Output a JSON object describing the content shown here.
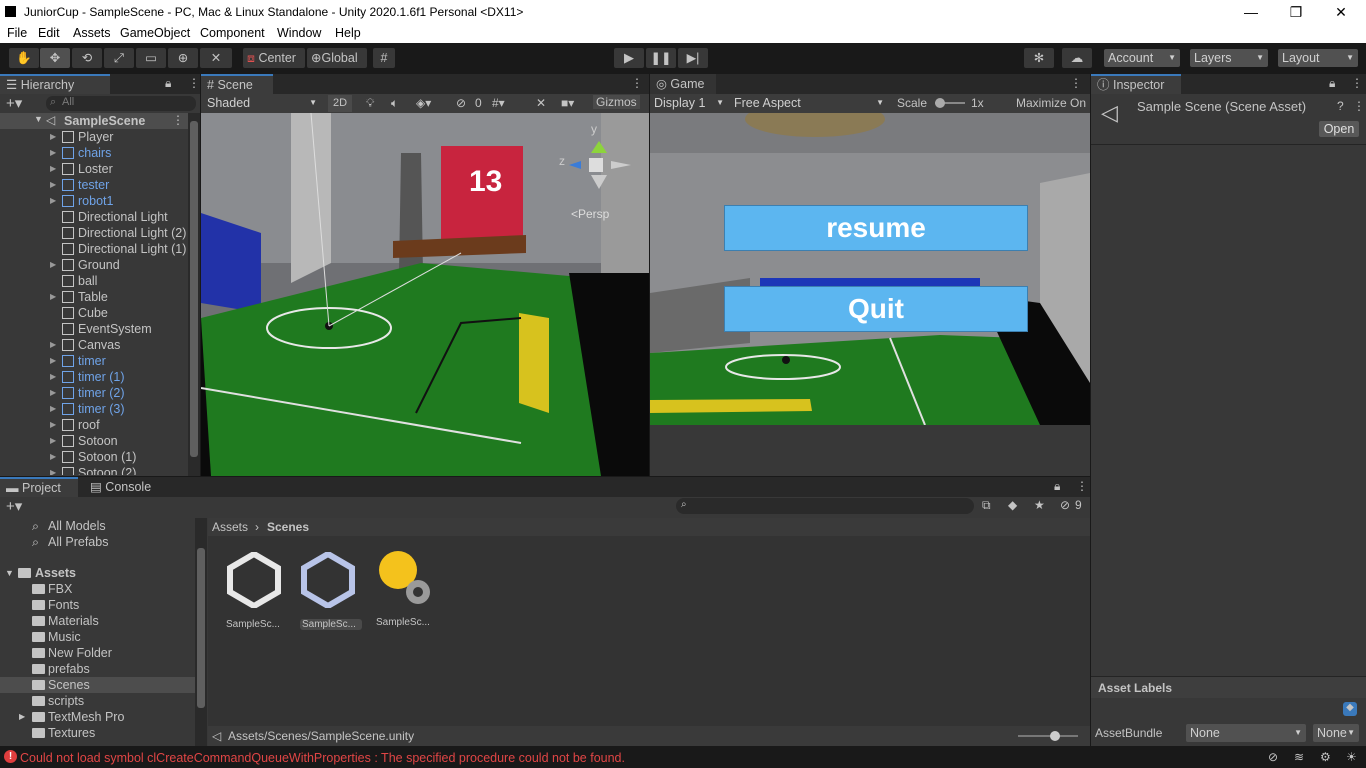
{
  "window": {
    "title": "JuniorCup - SampleScene - PC, Mac & Linux Standalone - Unity 2020.1.6f1 Personal <DX11>",
    "minimize": "—",
    "restore": "❐",
    "close": "✕"
  },
  "menu": [
    "File",
    "Edit",
    "Assets",
    "GameObject",
    "Component",
    "Window",
    "Help"
  ],
  "toolbar": {
    "center": "Center",
    "global": "Global",
    "account": "Account",
    "layers": "Layers",
    "layout": "Layout",
    "play_icon": "play-icon",
    "pause_icon": "pause-icon",
    "step_icon": "step-icon"
  },
  "hierarchy": {
    "tab": "Hierarchy",
    "search_placeholder": "All",
    "scene": "SampleScene",
    "items": [
      {
        "label": "Player",
        "prefab": false,
        "expand": true
      },
      {
        "label": "chairs",
        "prefab": true,
        "expand": true
      },
      {
        "label": "Loster",
        "prefab": false,
        "expand": true
      },
      {
        "label": "tester",
        "prefab": true,
        "expand": true
      },
      {
        "label": "robot1",
        "prefab": true,
        "expand": true
      },
      {
        "label": "Directional Light",
        "prefab": false,
        "expand": false
      },
      {
        "label": "Directional Light (2)",
        "prefab": false,
        "expand": false
      },
      {
        "label": "Directional Light (1)",
        "prefab": false,
        "expand": false
      },
      {
        "label": "Ground",
        "prefab": false,
        "expand": true
      },
      {
        "label": "ball",
        "prefab": false,
        "expand": false
      },
      {
        "label": "Table",
        "prefab": false,
        "expand": true
      },
      {
        "label": "Cube",
        "prefab": false,
        "expand": false
      },
      {
        "label": "EventSystem",
        "prefab": false,
        "expand": false
      },
      {
        "label": "Canvas",
        "prefab": false,
        "expand": true
      },
      {
        "label": "timer",
        "prefab": true,
        "expand": true
      },
      {
        "label": "timer (1)",
        "prefab": true,
        "expand": true
      },
      {
        "label": "timer (2)",
        "prefab": true,
        "expand": true
      },
      {
        "label": "timer (3)",
        "prefab": true,
        "expand": true
      },
      {
        "label": "roof",
        "prefab": false,
        "expand": true
      },
      {
        "label": "Sotoon",
        "prefab": false,
        "expand": true
      },
      {
        "label": "Sotoon (1)",
        "prefab": false,
        "expand": true
      },
      {
        "label": "Sotoon (2)",
        "prefab": false,
        "expand": true
      }
    ]
  },
  "scene": {
    "tab": "Scene",
    "shading": "Shaded",
    "mode2d": "2D",
    "hidden_count": "0",
    "gizmos": "Gizmos",
    "persp": "<Persp",
    "axis_y": "y",
    "axis_z": "z",
    "poster_number": "13"
  },
  "game": {
    "tab": "Game",
    "display": "Display 1",
    "aspect": "Free Aspect",
    "scale_label": "Scale",
    "scale_value": "1x",
    "maximize": "Maximize On",
    "resume_label": "resume",
    "quit_label": "Quit"
  },
  "inspector": {
    "tab": "Inspector",
    "title": "Sample Scene (Scene Asset)",
    "open": "Open",
    "asset_labels": "Asset Labels",
    "assetbundle_label": "AssetBundle",
    "bundle_value": "None",
    "variant_value": "None"
  },
  "project": {
    "tab": "Project",
    "console_tab": "Console",
    "favorites": [
      "All Models",
      "All Prefabs"
    ],
    "assets_root": "Assets",
    "folders": [
      "FBX",
      "Fonts",
      "Materials",
      "Music",
      "New Folder",
      "prefabs",
      "Scenes",
      "scripts",
      "TextMesh Pro",
      "Textures"
    ],
    "selected_folder": "Scenes",
    "breadcrumb": [
      "Assets",
      "Scenes"
    ],
    "files": [
      "SampleSc...",
      "SampleSc...",
      "SampleSc..."
    ],
    "path": "Assets/Scenes/SampleScene.unity",
    "hidden_count": "9"
  },
  "status": {
    "error": "Could not load symbol clCreateCommandQueueWithProperties : The specified procedure could not be found."
  }
}
